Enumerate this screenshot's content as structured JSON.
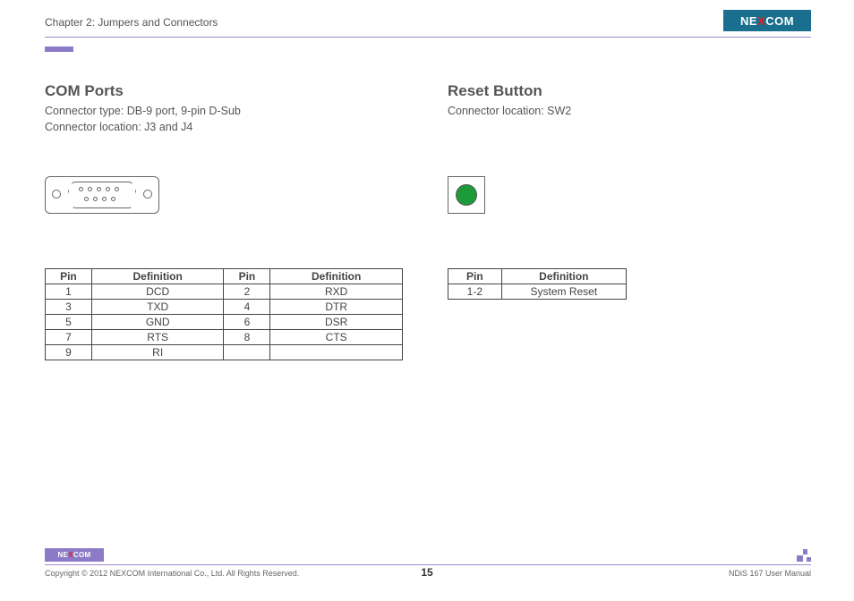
{
  "header": {
    "chapter": "Chapter 2: Jumpers and Connectors",
    "brand": "NEXCOM"
  },
  "com": {
    "title": "COM Ports",
    "line1": "Connector type: DB-9 port, 9-pin D-Sub",
    "line2": "Connector location: J3 and J4",
    "table": {
      "headers": {
        "pin": "Pin",
        "def": "Definition"
      },
      "rows": [
        {
          "p1": "1",
          "d1": "DCD",
          "p2": "2",
          "d2": "RXD"
        },
        {
          "p1": "3",
          "d1": "TXD",
          "p2": "4",
          "d2": "DTR"
        },
        {
          "p1": "5",
          "d1": "GND",
          "p2": "6",
          "d2": "DSR"
        },
        {
          "p1": "7",
          "d1": "RTS",
          "p2": "8",
          "d2": "CTS"
        },
        {
          "p1": "9",
          "d1": "RI",
          "p2": "",
          "d2": ""
        }
      ]
    }
  },
  "reset": {
    "title": "Reset Button",
    "line1": "Connector location: SW2",
    "table": {
      "headers": {
        "pin": "Pin",
        "def": "Definition"
      },
      "rows": [
        {
          "pin": "1-2",
          "def": "System Reset"
        }
      ]
    }
  },
  "footer": {
    "copyright": "Copyright © 2012 NEXCOM International Co., Ltd. All Rights Reserved.",
    "page": "15",
    "manual": "NDiS 167 User Manual"
  }
}
